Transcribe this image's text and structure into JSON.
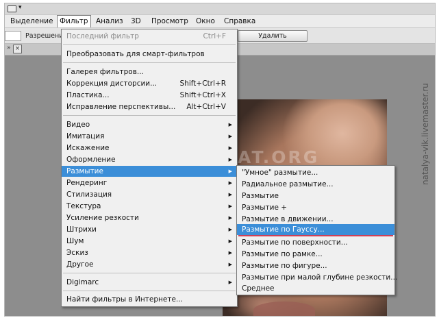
{
  "menubar": {
    "items": [
      {
        "label": "Выделение"
      },
      {
        "label": "Фильтр"
      },
      {
        "label": "Анализ"
      },
      {
        "label": "3D"
      },
      {
        "label": "Просмотр"
      },
      {
        "label": "Окно"
      },
      {
        "label": "Справка"
      }
    ]
  },
  "options_bar": {
    "label": "Разрешени",
    "delete_button": "Удалить"
  },
  "tabstrip": {
    "arrows": "»",
    "close": "×"
  },
  "filter_menu": {
    "items": [
      {
        "label": "Последний фильтр",
        "shortcut": "Ctrl+F"
      },
      {
        "label": "Преобразовать для смарт-фильтров"
      },
      {
        "label": "Галерея фильтров..."
      },
      {
        "label": "Коррекция дисторсии...",
        "shortcut": "Shift+Ctrl+R"
      },
      {
        "label": "Пластика...",
        "shortcut": "Shift+Ctrl+X"
      },
      {
        "label": "Исправление перспективы...",
        "shortcut": "Alt+Ctrl+V"
      },
      {
        "label": "Видео"
      },
      {
        "label": "Имитация"
      },
      {
        "label": "Искажение"
      },
      {
        "label": "Оформление"
      },
      {
        "label": "Размытие"
      },
      {
        "label": "Рендеринг"
      },
      {
        "label": "Стилизация"
      },
      {
        "label": "Текстура"
      },
      {
        "label": "Усиление резкости"
      },
      {
        "label": "Штрихи"
      },
      {
        "label": "Шум"
      },
      {
        "label": "Эскиз"
      },
      {
        "label": "Другое"
      },
      {
        "label": "Digimarc"
      },
      {
        "label": "Найти фильтры в Интернете..."
      }
    ]
  },
  "blur_submenu": {
    "items": [
      {
        "label": "\"Умное\" размытие..."
      },
      {
        "label": "Радиальное размытие..."
      },
      {
        "label": "Размытие"
      },
      {
        "label": "Размытие +"
      },
      {
        "label": "Размытие в движении..."
      },
      {
        "label": "Размытие по Гауссу..."
      },
      {
        "label": "Размытие по поверхности..."
      },
      {
        "label": "Размытие по рамке..."
      },
      {
        "label": "Размытие по фигуре..."
      },
      {
        "label": "Размытие при малой глубине резкости..."
      },
      {
        "label": "Среднее"
      }
    ]
  },
  "watermark": "KAK-SDELAT.ORG",
  "side_credit": "natalya-vik.livemaster.ru",
  "colors": {
    "highlight": "#3b8ed8",
    "underline": "#d04057"
  },
  "icons": {
    "submenu": "arrow-right-icon",
    "tab_close": "close-icon"
  }
}
